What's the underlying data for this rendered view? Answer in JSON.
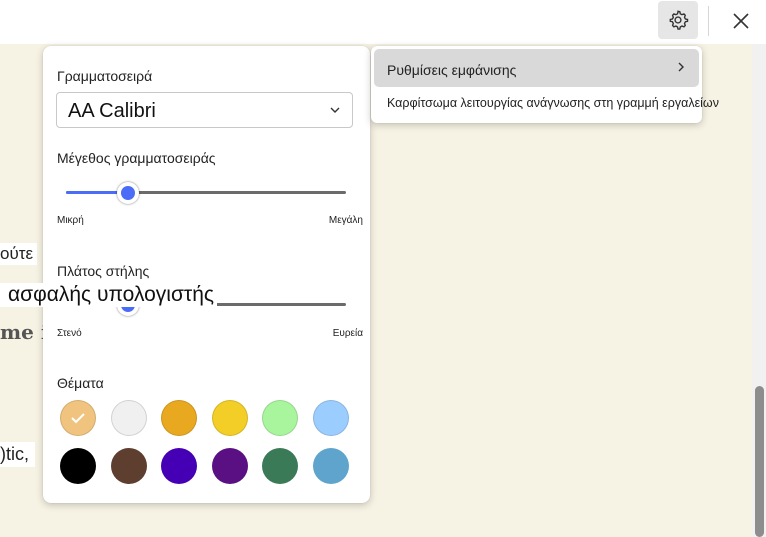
{
  "toolbar": {
    "settings_icon": "gear-icon",
    "close_icon": "close-icon"
  },
  "reader": {
    "fragments": [
      "ούτε",
      "ασφαλής υπολογιστής",
      "me i",
      ")tic,"
    ]
  },
  "panel": {
    "font_label": "Γραμματοσειρά",
    "font_value": "AA Calibri",
    "font_size": {
      "label": "Μέγεθος γραμματοσειράς",
      "min_label": "Μικρή",
      "max_label": "Μεγάλη",
      "value": 0.22
    },
    "column_width": {
      "label": "Πλάτος στήλης",
      "min_label": "Στενό",
      "max_label": "Ευρεία",
      "value": 0.22
    },
    "themes": {
      "label": "Θέματα",
      "selected_index": 0,
      "colors": [
        "#f0c47e",
        "#f0f0f0",
        "#e8a921",
        "#f2ce27",
        "#a9f59e",
        "#9ccdff",
        "#000000",
        "#5e3e2f",
        "#4500b5",
        "#5a0f82",
        "#3a7a57",
        "#5ea4cc"
      ]
    }
  },
  "menu": {
    "appearance_label": "Ρυθμίσεις εμφάνισης",
    "pin_label": "Καρφίτσωμα λειτουργίας ανάγνωσης στη γραμμή εργαλείων"
  },
  "colors": {
    "accent": "#4a6cf7",
    "reader_bg": "#f7f3e4"
  }
}
